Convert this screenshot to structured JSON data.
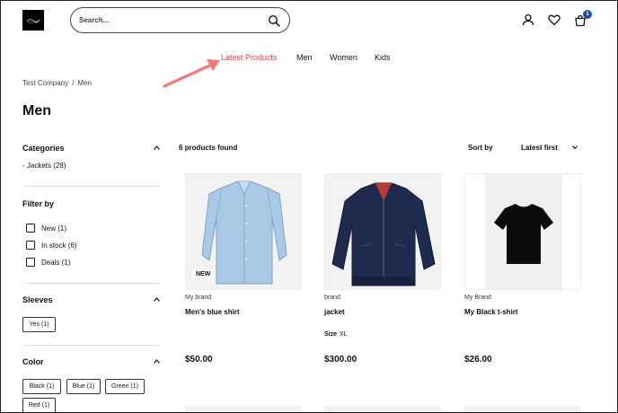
{
  "header": {
    "search_placeholder": "Search...",
    "cart_count": "1"
  },
  "nav": {
    "items": [
      {
        "label": "Latest Products",
        "active": true
      },
      {
        "label": "Men"
      },
      {
        "label": "Women"
      },
      {
        "label": "Kids"
      }
    ]
  },
  "breadcrumb": [
    "Test Company",
    "Men"
  ],
  "breadcrumb_separator": "/",
  "page_title": "Men",
  "sidebar": {
    "categories": {
      "heading": "Categories",
      "items": [
        "- Jackets (28)"
      ]
    },
    "filter_by": {
      "heading": "Filter by",
      "options": [
        "New (1)",
        "In stock (6)",
        "Deals (1)"
      ]
    },
    "sleeves": {
      "heading": "Sleeves",
      "chips": [
        "Yes (1)"
      ]
    },
    "color": {
      "heading": "Color",
      "chips": [
        "Black (1)",
        "Blue (1)",
        "Green (1)",
        "Red (1)"
      ]
    }
  },
  "results": {
    "count_text": "6 products found",
    "sort_label": "Sort by",
    "sort_value": "Latest first"
  },
  "products": [
    {
      "brand": "My brand",
      "name": "Men's blue shirt",
      "price": "$50.00",
      "badge": "NEW"
    },
    {
      "brand": "brand",
      "name": "jacket",
      "size_label": "Size",
      "size_value": "XL",
      "price": "$300.00"
    },
    {
      "brand": "My Brand",
      "name": "My Black t-shirt",
      "price": "$26.00"
    }
  ],
  "colors": {
    "accent": "#d64545",
    "badge": "#1d4f91",
    "arrow": "#f07b7b"
  }
}
